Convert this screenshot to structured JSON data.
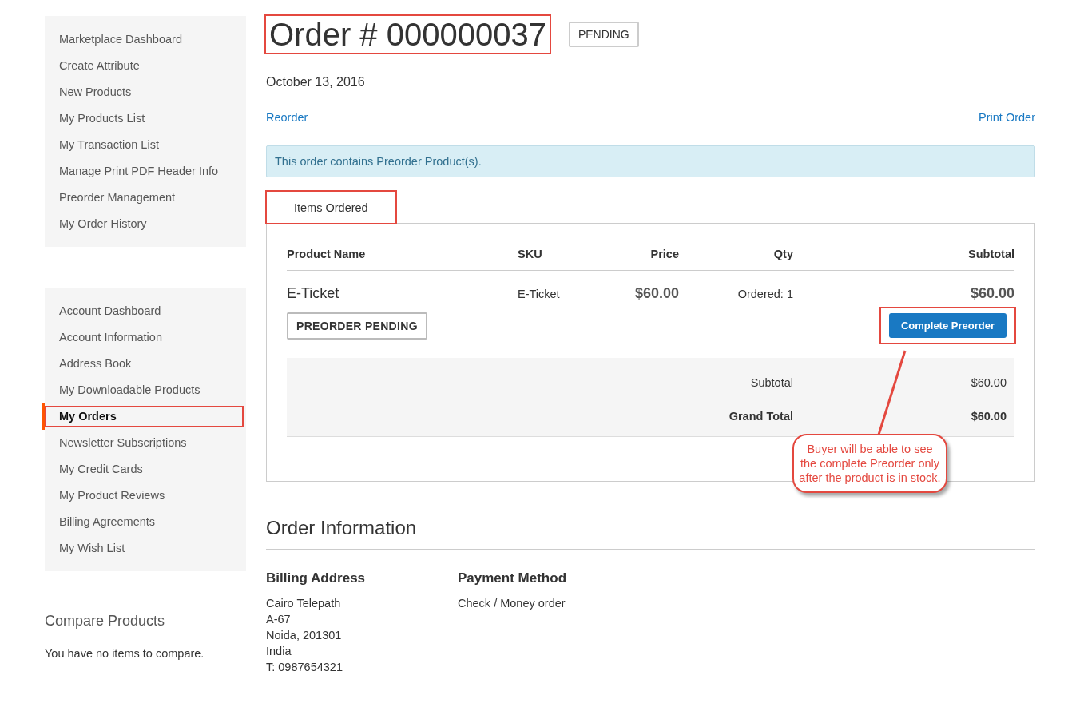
{
  "sidebar": {
    "groups": [
      {
        "items": [
          {
            "label": "Marketplace Dashboard",
            "selected": false,
            "highlighted": false
          },
          {
            "label": "Create Attribute",
            "selected": false,
            "highlighted": false
          },
          {
            "label": "New Products",
            "selected": false,
            "highlighted": false
          },
          {
            "label": "My Products List",
            "selected": false,
            "highlighted": false
          },
          {
            "label": "My Transaction List",
            "selected": false,
            "highlighted": false
          },
          {
            "label": "Manage Print PDF Header Info",
            "selected": false,
            "highlighted": false
          },
          {
            "label": "Preorder Management",
            "selected": false,
            "highlighted": false
          },
          {
            "label": "My Order History",
            "selected": false,
            "highlighted": false
          }
        ]
      },
      {
        "items": [
          {
            "label": "Account Dashboard",
            "selected": false,
            "highlighted": false
          },
          {
            "label": "Account Information",
            "selected": false,
            "highlighted": false
          },
          {
            "label": "Address Book",
            "selected": false,
            "highlighted": false
          },
          {
            "label": "My Downloadable Products",
            "selected": false,
            "highlighted": false
          },
          {
            "label": "My Orders",
            "selected": true,
            "highlighted": true
          },
          {
            "label": "Newsletter Subscriptions",
            "selected": false,
            "highlighted": false
          },
          {
            "label": "My Credit Cards",
            "selected": false,
            "highlighted": false
          },
          {
            "label": "My Product Reviews",
            "selected": false,
            "highlighted": false
          },
          {
            "label": "Billing Agreements",
            "selected": false,
            "highlighted": false
          },
          {
            "label": "My Wish List",
            "selected": false,
            "highlighted": false
          }
        ]
      }
    ],
    "compare": {
      "title": "Compare Products",
      "text": "You have no items to compare."
    }
  },
  "order": {
    "title": "Order # 000000037",
    "title_highlighted": true,
    "status": "PENDING",
    "date": "October 13, 2016",
    "reorder": "Reorder",
    "print": "Print Order",
    "notice": "This order contains Preorder Product(s).",
    "tabs": [
      {
        "label": "Items Ordered",
        "selected": true,
        "highlighted": true
      }
    ],
    "columns": [
      "Product Name",
      "SKU",
      "Price",
      "Qty",
      "Subtotal"
    ],
    "rows": [
      {
        "name": "E-Ticket",
        "sku": "E-Ticket",
        "price": "$60.00",
        "qty": "Ordered: 1",
        "subtotal": "$60.00",
        "badge": "PREORDER PENDING",
        "action": "Complete Preorder",
        "action_highlighted": true
      }
    ],
    "totals": [
      {
        "label": "Subtotal",
        "value": "$60.00",
        "kind": "normal"
      },
      {
        "label": "Grand Total",
        "value": "$60.00",
        "kind": "grand"
      }
    ],
    "callout": "Buyer will be able to see the complete Preorder only after the product is in stock."
  },
  "info": {
    "title": "Order Information",
    "blocks": [
      {
        "title": "Billing Address",
        "lines": [
          "Cairo Telepath",
          "A-67",
          "Noida, 201301",
          "India",
          "T: 0987654321"
        ]
      },
      {
        "title": "Payment Method",
        "lines": [
          "Check / Money order"
        ]
      }
    ]
  }
}
